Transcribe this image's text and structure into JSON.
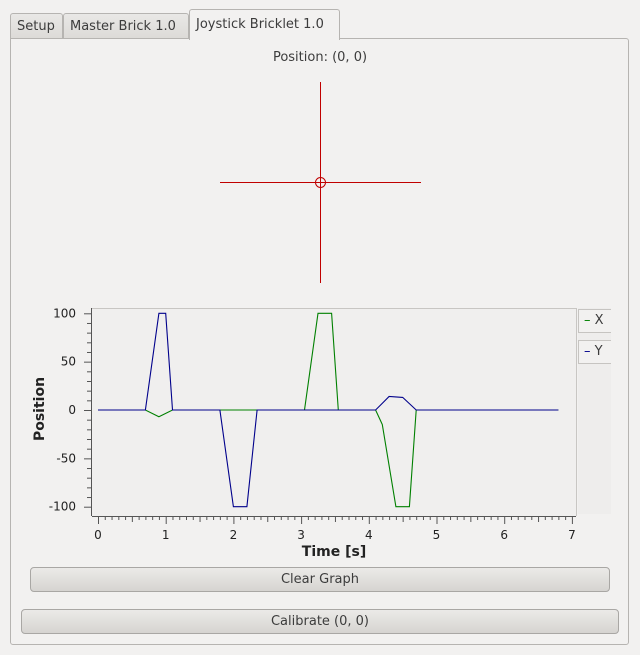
{
  "tabs": [
    {
      "label": "Setup"
    },
    {
      "label": "Master Brick 1.0"
    },
    {
      "label": "Joystick Bricklet 1.0"
    }
  ],
  "position": {
    "label": "Position: (0, 0)",
    "x": 0,
    "y": 0
  },
  "buttons": {
    "clear_graph": "Clear Graph",
    "calibrate": "Calibrate (0, 0)"
  },
  "colors": {
    "crosshair": "#c00000",
    "series_x": "#008000",
    "series_y": "#00008b"
  },
  "chart_data": {
    "type": "line",
    "xlabel": "Time [s]",
    "ylabel": "Position",
    "xlim": [
      0,
      7
    ],
    "ylim": [
      -105,
      105
    ],
    "x_ticks": [
      0,
      1,
      2,
      3,
      4,
      5,
      6,
      7
    ],
    "y_ticks": [
      -100,
      -50,
      0,
      50,
      100
    ],
    "legend": [
      "X",
      "Y"
    ],
    "legend_position": "right",
    "series": [
      {
        "name": "X",
        "color": "#008000",
        "x": [
          0,
          0.7,
          0.9,
          1.1,
          1.8,
          2.35,
          3.05,
          3.25,
          3.45,
          3.55,
          4.1,
          4.2,
          4.4,
          4.6,
          4.7,
          6.8
        ],
        "y": [
          0,
          0,
          -7,
          0,
          0,
          0,
          0,
          100,
          100,
          0,
          0,
          -15,
          -100,
          -100,
          0,
          0
        ]
      },
      {
        "name": "Y",
        "color": "#00008b",
        "x": [
          0,
          0.7,
          0.9,
          1.0,
          1.1,
          1.8,
          2.0,
          2.2,
          2.35,
          3.05,
          3.55,
          4.1,
          4.3,
          4.5,
          4.7,
          6.8
        ],
        "y": [
          0,
          0,
          100,
          100,
          0,
          0,
          -100,
          -100,
          0,
          0,
          0,
          0,
          14,
          13,
          0,
          0
        ]
      }
    ]
  }
}
